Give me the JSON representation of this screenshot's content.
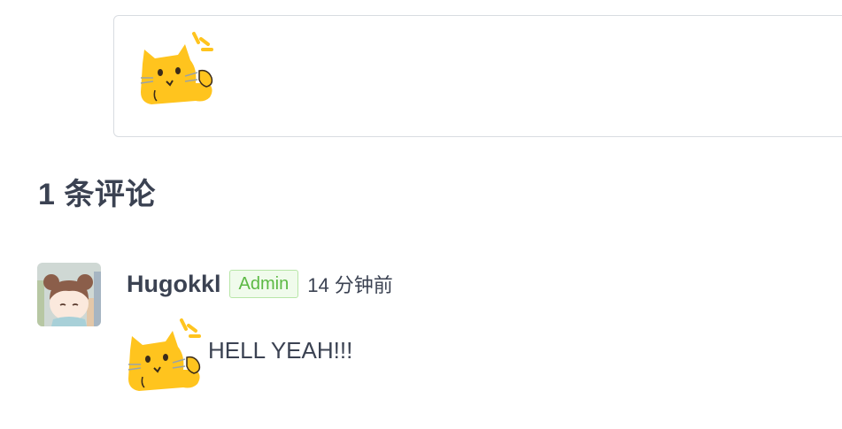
{
  "editor": {
    "content_emoji": "cat-alert-emoji"
  },
  "comments_section": {
    "title": "1 条评论"
  },
  "comment": {
    "avatar": "user-avatar",
    "author": "Hugokkl",
    "badge": "Admin",
    "time": "14 分钟前",
    "emoji": "cat-alert-emoji",
    "text": "HELL YEAH!!!"
  },
  "colors": {
    "text": "#3b4252",
    "badge_text": "#5cb944",
    "badge_border": "#b7e6a7",
    "badge_bg": "#f0fbec",
    "emoji_yellow": "#ffc41e",
    "box_border": "#d8dce1"
  }
}
